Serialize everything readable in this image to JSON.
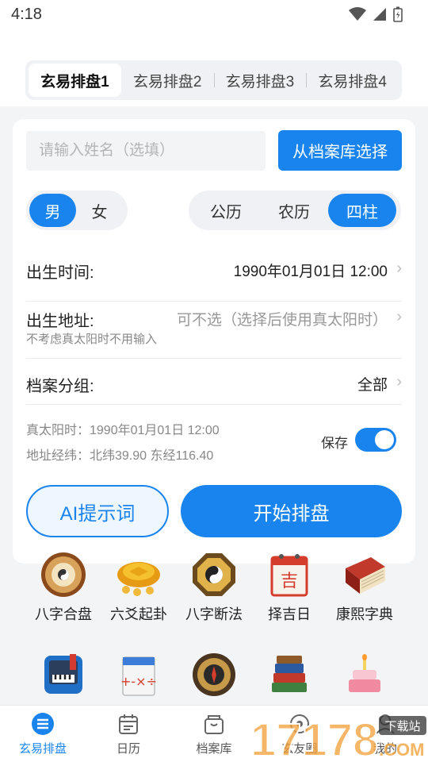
{
  "status_bar": {
    "time": "4:18"
  },
  "tabs": [
    {
      "label": "玄易排盘1",
      "active": true
    },
    {
      "label": "玄易排盘2",
      "active": false
    },
    {
      "label": "玄易排盘3",
      "active": false
    },
    {
      "label": "玄易排盘4",
      "active": false
    }
  ],
  "form": {
    "name_placeholder": "请输入姓名（选填）",
    "name_value": "",
    "archive_button": "从档案库选择",
    "gender": {
      "options": [
        "男",
        "女"
      ],
      "selected": "男"
    },
    "calendar": {
      "options": [
        "公历",
        "农历",
        "四柱"
      ],
      "selected": "四柱"
    },
    "birth_time": {
      "label": "出生时间:",
      "value": "1990年01月01日 12:00"
    },
    "birth_place": {
      "label": "出生地址:",
      "value": "可不选（选择后使用真太阳时）",
      "hint": "不考虑真太阳时不用输入"
    },
    "group": {
      "label": "档案分组:",
      "value": "全部"
    },
    "true_solar_time": "真太阳时：1990年01月01日 12:00",
    "coordinates": "地址经纬：北纬39.90 东经116.40",
    "save_label": "保存",
    "save_enabled": true,
    "ai_button": "AI提示词",
    "start_button": "开始排盘"
  },
  "tools_row1": [
    {
      "label": "八字合盘",
      "icon": "bagua-plate-icon"
    },
    {
      "label": "六爻起卦",
      "icon": "tortoise-shell-icon"
    },
    {
      "label": "八字断法",
      "icon": "bagua-mirror-icon"
    },
    {
      "label": "择吉日",
      "icon": "lucky-calendar-icon"
    },
    {
      "label": "康熙字典",
      "icon": "dictionary-book-icon"
    }
  ],
  "tools_row2": [
    {
      "icon": "piano-icon"
    },
    {
      "icon": "math-calendar-icon"
    },
    {
      "icon": "compass-icon"
    },
    {
      "icon": "book-stack-icon"
    },
    {
      "icon": "birthday-cake-icon"
    }
  ],
  "bottom_nav": [
    {
      "label": "玄易排盘",
      "active": true
    },
    {
      "label": "日历",
      "active": false
    },
    {
      "label": "档案库",
      "active": false
    },
    {
      "label": "玄友圈",
      "active": false
    },
    {
      "label": "我的",
      "active": false
    }
  ],
  "watermark": {
    "text": "17178",
    "sub": "下载站",
    "domain": ".COM"
  },
  "colors": {
    "accent": "#1a84ee",
    "background": "#f3f4f6"
  }
}
